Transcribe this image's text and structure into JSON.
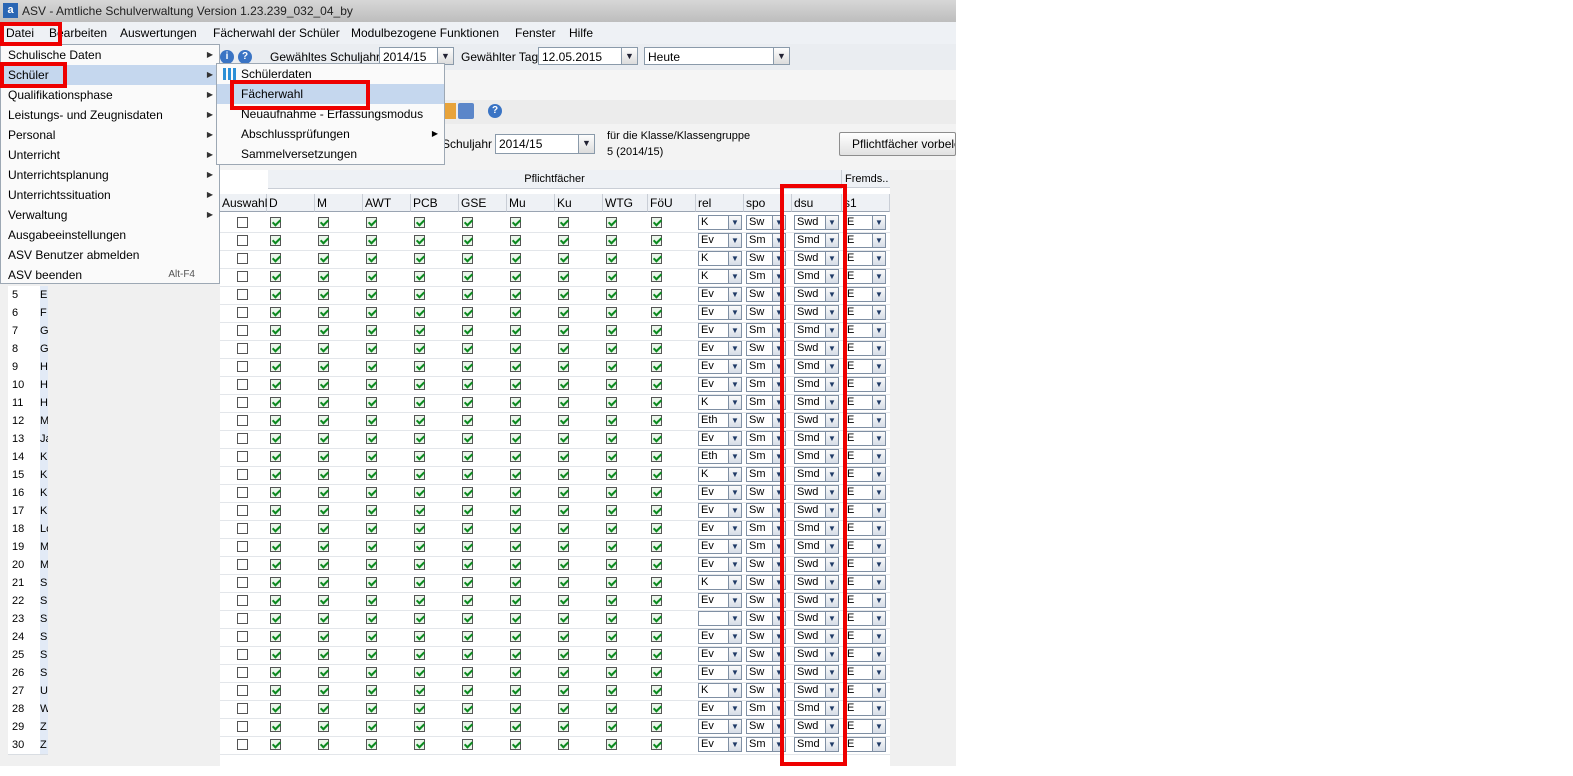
{
  "window": {
    "title": "ASV - Amtliche Schulverwaltung Version 1.23.239_032_04_by",
    "app_icon_letter": "a"
  },
  "menubar": [
    "Datei",
    "Bearbeiten",
    "Auswertungen",
    "Fächerwahl der Schüler",
    "Modulbezogene Funktionen",
    "Fenster",
    "Hilfe"
  ],
  "toolbar": {
    "schuljahr_label": "Gewähltes Schuljahr",
    "schuljahr_value": "2014/15",
    "tag_label": "Gewählter Tag",
    "tag_value": "12.05.2015",
    "heute_value": "Heute"
  },
  "filter": {
    "schuljahr_label": "Schuljahr",
    "schuljahr_value": "2014/15",
    "klasse_label": "für die Klasse/Klassengruppe",
    "klasse_value": "5 (2014/15)",
    "button_label": "Pflichtfächer vorbele"
  },
  "file_menu": [
    {
      "label": "Schulische Daten",
      "submenu": true
    },
    {
      "label": "Schüler",
      "submenu": true,
      "highlighted": true
    },
    {
      "label": "Qualifikationsphase",
      "submenu": true
    },
    {
      "label": "Leistungs- und Zeugnisdaten",
      "submenu": true
    },
    {
      "label": "Personal",
      "submenu": true
    },
    {
      "label": "Unterricht",
      "submenu": true
    },
    {
      "label": "Unterrichtsplanung",
      "submenu": true
    },
    {
      "label": "Unterrichtssituation",
      "submenu": true
    },
    {
      "label": "Verwaltung",
      "submenu": true
    },
    {
      "label": "Ausgabeeinstellungen",
      "submenu": false
    },
    {
      "label": "ASV Benutzer abmelden",
      "submenu": false
    },
    {
      "label": "ASV beenden",
      "submenu": false,
      "shortcut": "Alt-F4"
    }
  ],
  "schueler_submenu": [
    {
      "label": "Schülerdaten",
      "icon": "students-icon"
    },
    {
      "label": "Fächerwahl",
      "highlighted": true
    },
    {
      "label": "Neuaufnahme - Erfassungsmodus"
    },
    {
      "label": "Abschlussprüfungen",
      "submenu": true
    },
    {
      "label": "Sammelversetzungen"
    }
  ],
  "grid": {
    "group_header": "Pflichtfächer",
    "group_header2": "Fremds..",
    "columns": [
      "Auswahl",
      "D",
      "M",
      "AWT",
      "PCB",
      "GSE",
      "Mu",
      "Ku",
      "WTG",
      "FöU",
      "rel",
      "spo",
      "dsu",
      "s1"
    ],
    "rows": [
      {
        "no": "",
        "initial": "",
        "rel": "K",
        "spo": "Sw",
        "dsu": "Swd",
        "s1": "E"
      },
      {
        "no": "",
        "initial": "",
        "rel": "Ev",
        "spo": "Sm",
        "dsu": "Smd",
        "s1": "E"
      },
      {
        "no": "",
        "initial": "",
        "rel": "K",
        "spo": "Sw",
        "dsu": "Swd",
        "s1": "E"
      },
      {
        "no": "",
        "initial": "",
        "rel": "K",
        "spo": "Sm",
        "dsu": "Smd",
        "s1": "E"
      },
      {
        "no": "5",
        "initial": "E",
        "rel": "Ev",
        "spo": "Sw",
        "dsu": "Swd",
        "s1": "E"
      },
      {
        "no": "6",
        "initial": "F",
        "rel": "Ev",
        "spo": "Sw",
        "dsu": "Swd",
        "s1": "E"
      },
      {
        "no": "7",
        "initial": "G",
        "rel": "Ev",
        "spo": "Sm",
        "dsu": "Smd",
        "s1": "E"
      },
      {
        "no": "8",
        "initial": "G",
        "rel": "Ev",
        "spo": "Sw",
        "dsu": "Swd",
        "s1": "E"
      },
      {
        "no": "9",
        "initial": "H",
        "rel": "Ev",
        "spo": "Sm",
        "dsu": "Smd",
        "s1": "E"
      },
      {
        "no": "10",
        "initial": "H",
        "rel": "Ev",
        "spo": "Sm",
        "dsu": "Smd",
        "s1": "E"
      },
      {
        "no": "11",
        "initial": "H",
        "rel": "K",
        "spo": "Sm",
        "dsu": "Smd",
        "s1": "E"
      },
      {
        "no": "12",
        "initial": "M",
        "rel": "Eth",
        "spo": "Sw",
        "dsu": "Swd",
        "s1": "E"
      },
      {
        "no": "13",
        "initial": "Ja",
        "rel": "Ev",
        "spo": "Sm",
        "dsu": "Smd",
        "s1": "E"
      },
      {
        "no": "14",
        "initial": "K",
        "rel": "Eth",
        "spo": "Sm",
        "dsu": "Smd",
        "s1": "E"
      },
      {
        "no": "15",
        "initial": "K",
        "rel": "K",
        "spo": "Sm",
        "dsu": "Smd",
        "s1": "E"
      },
      {
        "no": "16",
        "initial": "K",
        "rel": "Ev",
        "spo": "Sw",
        "dsu": "Swd",
        "s1": "E"
      },
      {
        "no": "17",
        "initial": "K",
        "rel": "Ev",
        "spo": "Sw",
        "dsu": "Swd",
        "s1": "E"
      },
      {
        "no": "18",
        "initial": "Lo",
        "rel": "Ev",
        "spo": "Sm",
        "dsu": "Smd",
        "s1": "E"
      },
      {
        "no": "19",
        "initial": "M",
        "rel": "Ev",
        "spo": "Sm",
        "dsu": "Smd",
        "s1": "E"
      },
      {
        "no": "20",
        "initial": "M",
        "rel": "Ev",
        "spo": "Sw",
        "dsu": "Swd",
        "s1": "E"
      },
      {
        "no": "21",
        "initial": "S",
        "rel": "K",
        "spo": "Sw",
        "dsu": "Swd",
        "s1": "E"
      },
      {
        "no": "22",
        "initial": "S",
        "rel": "Ev",
        "spo": "Sw",
        "dsu": "Swd",
        "s1": "E"
      },
      {
        "no": "23",
        "initial": "S",
        "rel": "",
        "spo": "Sw",
        "dsu": "Swd",
        "s1": "E"
      },
      {
        "no": "24",
        "initial": "S",
        "rel": "Ev",
        "spo": "Sw",
        "dsu": "Swd",
        "s1": "E"
      },
      {
        "no": "25",
        "initial": "S",
        "rel": "Ev",
        "spo": "Sw",
        "dsu": "Swd",
        "s1": "E"
      },
      {
        "no": "26",
        "initial": "S",
        "rel": "Ev",
        "spo": "Sw",
        "dsu": "Swd",
        "s1": "E"
      },
      {
        "no": "27",
        "initial": "U",
        "rel": "K",
        "spo": "Sw",
        "dsu": "Swd",
        "s1": "E"
      },
      {
        "no": "28",
        "initial": "W",
        "rel": "Ev",
        "spo": "Sm",
        "dsu": "Smd",
        "s1": "E"
      },
      {
        "no": "29",
        "initial": "Z",
        "rel": "Ev",
        "spo": "Sw",
        "dsu": "Swd",
        "s1": "E"
      },
      {
        "no": "30",
        "initial": "Z",
        "rel": "Ev",
        "spo": "Sm",
        "dsu": "Smd",
        "s1": "E"
      }
    ]
  },
  "colors": {
    "annotation_red": "#ee0000",
    "menu_highlight": "#c5d7ee",
    "check_green": "#0b8a1f"
  }
}
